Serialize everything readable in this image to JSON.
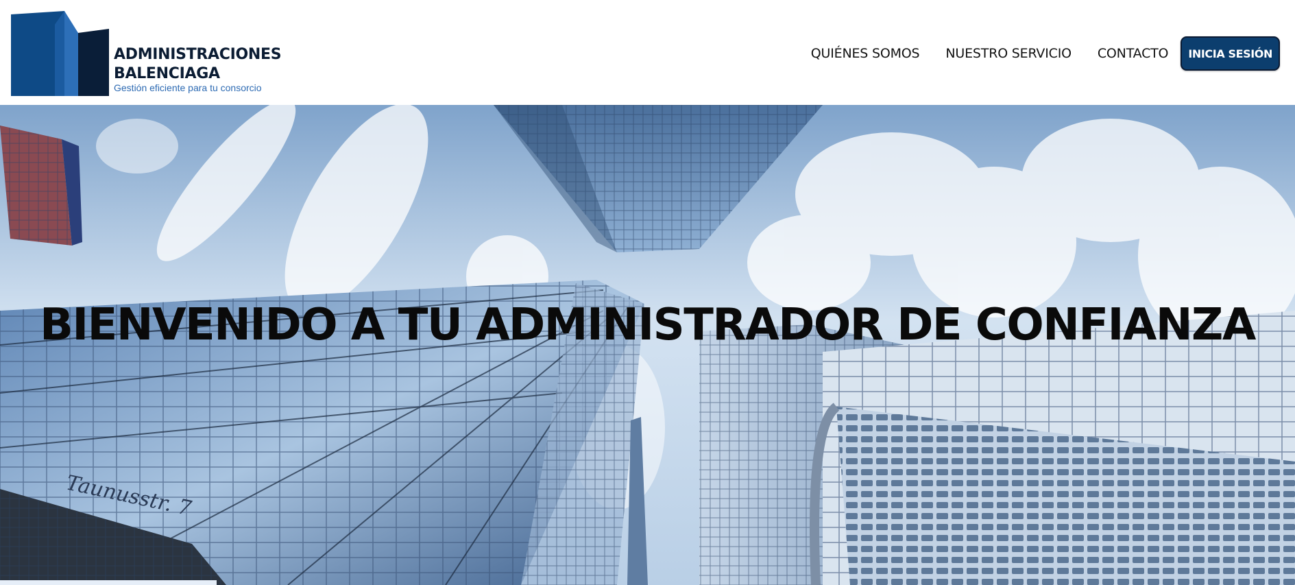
{
  "header": {
    "brand": {
      "name_line1": "ADMINISTRACIONES",
      "name_line2": "BALENCIAGA",
      "tagline": "Gestión eficiente para tu consorcio",
      "logo_icon": "building-logo-icon"
    },
    "nav": {
      "items": [
        {
          "label": "QUIÉNES SOMOS"
        },
        {
          "label": "NUESTRO SERVICIO"
        },
        {
          "label": "CONTACTO"
        }
      ],
      "login_label": "INICIA SESIÓN"
    }
  },
  "hero": {
    "title": "BIENVENIDO A TU ADMINISTRADOR DE CONFIANZA",
    "background": "skyscrapers-looking-up-photo",
    "street_sign": "Taunusstr. 7"
  },
  "colors": {
    "brand_dark": "#0b1c33",
    "brand_blue": "#0c3e6e",
    "accent_blue": "#2e6bb3",
    "sky": "#c9dcee"
  }
}
